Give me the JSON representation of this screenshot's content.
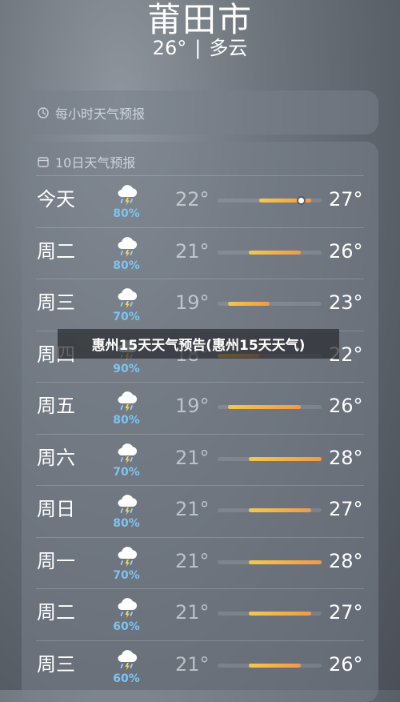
{
  "header": {
    "city": "莆田市",
    "temperature": "26°",
    "separator": "|",
    "condition": "多云"
  },
  "hourly": {
    "label": "每小时天气预报",
    "icon": "clock-icon"
  },
  "daily": {
    "label": "10日天气预报",
    "icon": "calendar-icon",
    "weather_icon": "thunderstorm-rain-icon",
    "temp_range": [
      18,
      28
    ],
    "days": [
      {
        "day": "今天",
        "precip": "80%",
        "low": "22°",
        "high": "27°",
        "current_temp": 26
      },
      {
        "day": "周二",
        "precip": "80%",
        "low": "21°",
        "high": "26°"
      },
      {
        "day": "周三",
        "precip": "70%",
        "low": "19°",
        "high": "23°"
      },
      {
        "day": "周四",
        "precip": "90%",
        "low": "18°",
        "high": "22°"
      },
      {
        "day": "周五",
        "precip": "80%",
        "low": "19°",
        "high": "26°"
      },
      {
        "day": "周六",
        "precip": "70%",
        "low": "21°",
        "high": "28°"
      },
      {
        "day": "周日",
        "precip": "80%",
        "low": "21°",
        "high": "27°"
      },
      {
        "day": "周一",
        "precip": "70%",
        "low": "21°",
        "high": "28°"
      },
      {
        "day": "周二",
        "precip": "60%",
        "low": "21°",
        "high": "27°"
      },
      {
        "day": "周三",
        "precip": "60%",
        "low": "21°",
        "high": "26°"
      }
    ]
  },
  "banner": {
    "text": "惠州15天天气预告(惠州15天天气)"
  },
  "colors": {
    "precip": "#7cc4f2",
    "bar_start": "#f2c94c",
    "bar_end": "#f2994a"
  }
}
